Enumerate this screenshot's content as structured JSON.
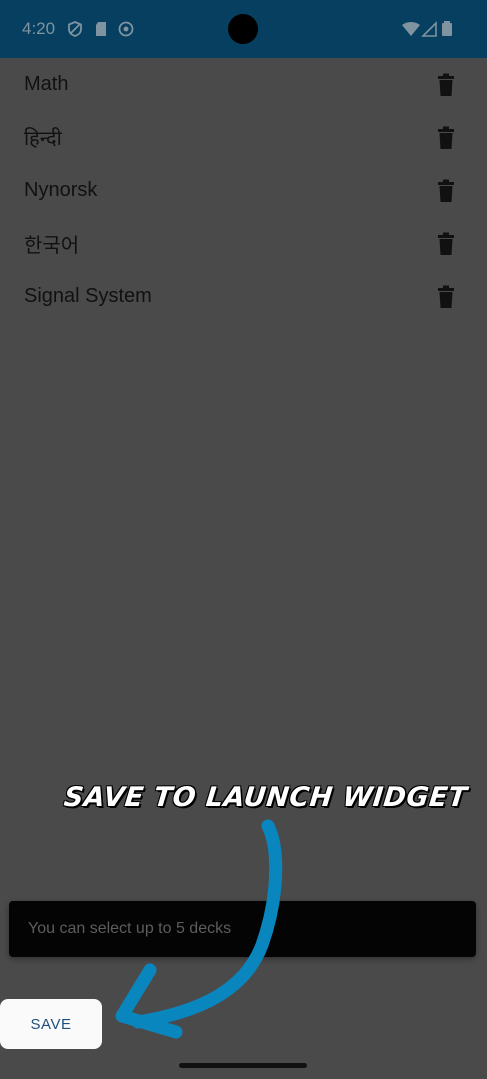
{
  "status_bar": {
    "time": "4:20",
    "icons": [
      "vpn-shield-icon",
      "sd-card-icon",
      "sync-icon",
      "wifi-icon",
      "signal-icon",
      "battery-icon"
    ]
  },
  "decks": [
    {
      "name": "Math",
      "delete_icon": "trash-icon"
    },
    {
      "name": "हिन्दी",
      "delete_icon": "trash-icon"
    },
    {
      "name": "Nynorsk",
      "delete_icon": "trash-icon"
    },
    {
      "name": "한국어",
      "delete_icon": "trash-icon"
    },
    {
      "name": "Signal System",
      "delete_icon": "trash-icon"
    }
  ],
  "annotation": {
    "text": "SAVE TO LAUNCH WIDGET",
    "arrow_color": "#0a86bf"
  },
  "snackbar": {
    "message": "You can select up to 5 decks"
  },
  "save_button": {
    "label": "SAVE"
  },
  "colors": {
    "status_bar": "#063f5f",
    "scrim_background": "#4a4a4a",
    "accent": "#1e4f7a"
  }
}
